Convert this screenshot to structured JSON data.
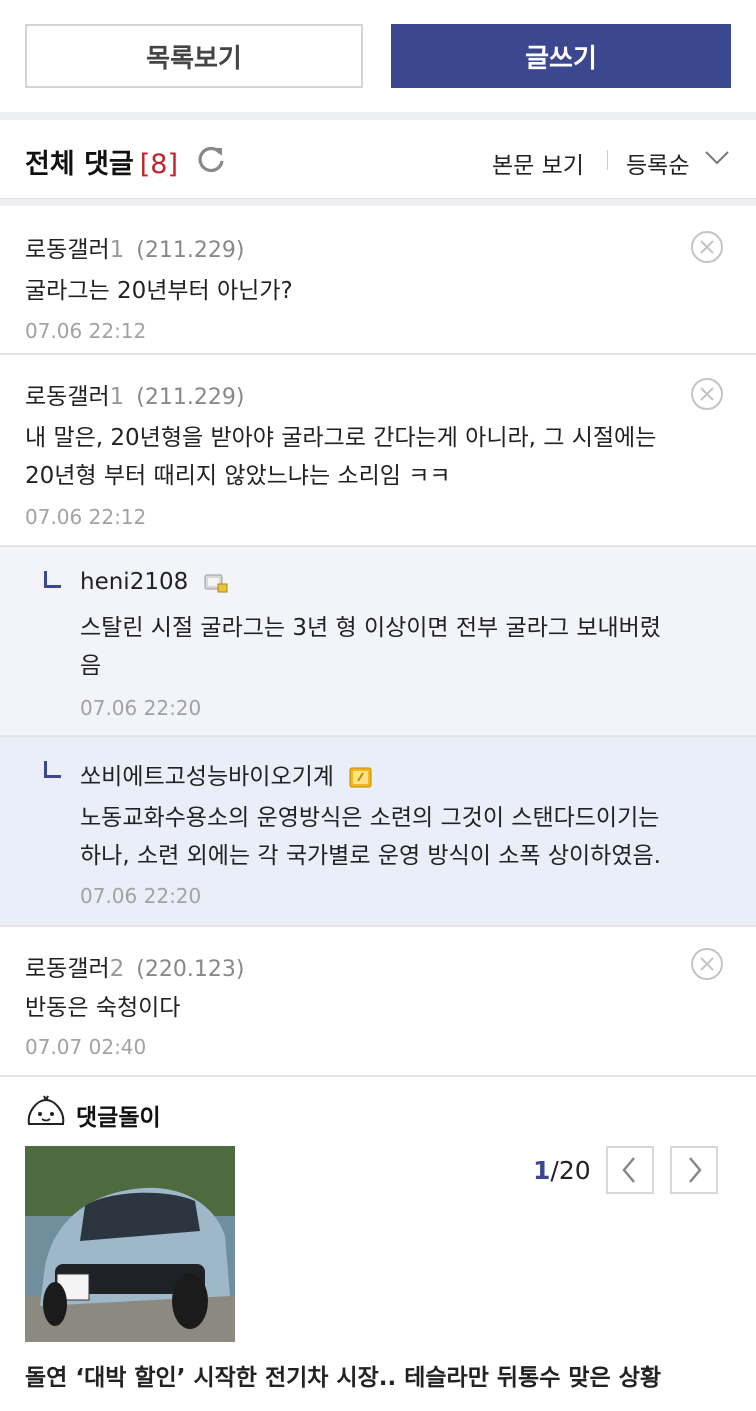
{
  "top": {
    "list_label": "목록보기",
    "write_label": "글쓰기"
  },
  "comments_header": {
    "title": "전체 댓글",
    "count": "[8]",
    "view_body": "본문 보기",
    "sort": "등록순"
  },
  "comments": [
    {
      "nick": "로동갤러",
      "num": "1",
      "ip": "(211.229)",
      "text": "굴라그는 20년부터 아닌가?",
      "date": "07.06 22:12"
    },
    {
      "nick": "로동갤러",
      "num": "1",
      "ip": "(211.229)",
      "text_l1": "내 말은, 20년형을 받아야 굴라그로 간다는게 아니라, 그 시절에는",
      "text_l2": "20년형 부터 때리지 않았느냐는 소리임 ㅋㅋ",
      "date": "07.06 22:12"
    },
    {
      "nick": "로동갤러",
      "num": "2",
      "ip": "(220.123)",
      "text": "반동은 숙청이다",
      "date": "07.07 02:40"
    }
  ],
  "replies": [
    {
      "nick": "heni2108",
      "text_l1": "스탈린 시절 굴라그는 3년 형 이상이면 전부 굴라그 보내버렸",
      "text_l2": "음",
      "date": "07.06 22:20"
    },
    {
      "nick": "쏘비에트고성능바이오기계",
      "text_l1": "노동교화수용소의 운영방식은 소련의 그것이 스탠다드이기는",
      "text_l2": "하나, 소련 외에는 각 국가별로 운영 방식이 소폭 상이하였음.",
      "date": "07.06 22:20"
    }
  ],
  "bottom": {
    "title": "댓글돌이",
    "page_current": "1",
    "page_total": "/20",
    "headline": "돌연 ‘대박 할인’ 시작한 전기차 시장.. 테슬라만 뒤통수 맞은 상황"
  }
}
